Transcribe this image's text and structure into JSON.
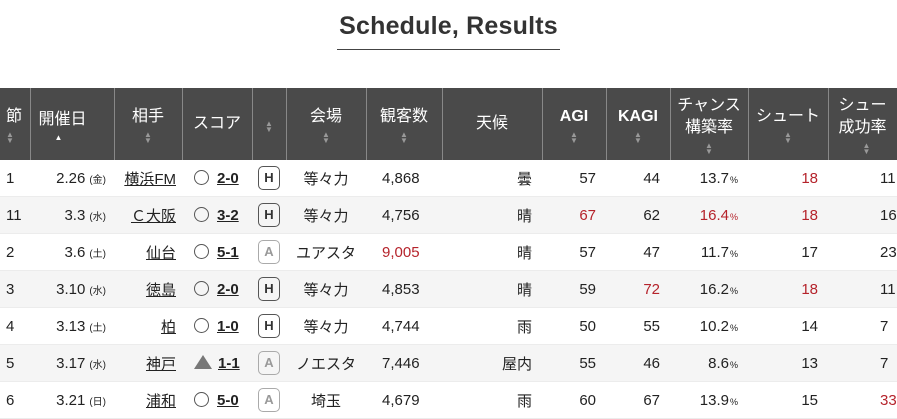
{
  "title": "Schedule, Results",
  "headers": {
    "sec": "節",
    "date": "開催日",
    "opponent": "相手",
    "score": "スコア",
    "venue": "会場",
    "attendance": "観客数",
    "weather": "天候",
    "agi": "AGI",
    "kagi": "KAGI",
    "chance_line1": "チャンス",
    "chance_line2": "構築率",
    "shoot": "シュート",
    "shoot_rate_line1": "シュー",
    "shoot_rate_line2": "成功率"
  },
  "rows": [
    {
      "sec": "1",
      "date": "2.26",
      "dow": "(金)",
      "opponent": "横浜FM",
      "result": "circle",
      "score": "2-0",
      "ha": "H",
      "venue": "等々力",
      "attendance": "4,868",
      "att_red": false,
      "weather": "曇",
      "agi": "57",
      "agi_red": false,
      "kagi": "44",
      "kagi_red": false,
      "chance": "13.7",
      "chance_red": false,
      "shoot": "18",
      "shoot_red": true,
      "sr": "11",
      "sr_red": false
    },
    {
      "sec": "11",
      "date": "3.3",
      "dow": "(水)",
      "opponent": "Ｃ大阪",
      "result": "circle",
      "score": "3-2",
      "ha": "H",
      "venue": "等々力",
      "attendance": "4,756",
      "att_red": false,
      "weather": "晴",
      "agi": "67",
      "agi_red": true,
      "kagi": "62",
      "kagi_red": false,
      "chance": "16.4",
      "chance_red": true,
      "shoot": "18",
      "shoot_red": true,
      "sr": "16",
      "sr_red": false
    },
    {
      "sec": "2",
      "date": "3.6",
      "dow": "(土)",
      "opponent": "仙台",
      "result": "circle",
      "score": "5-1",
      "ha": "A",
      "venue": "ユアスタ",
      "attendance": "9,005",
      "att_red": true,
      "weather": "晴",
      "agi": "57",
      "agi_red": false,
      "kagi": "47",
      "kagi_red": false,
      "chance": "11.7",
      "chance_red": false,
      "shoot": "17",
      "shoot_red": false,
      "sr": "23",
      "sr_red": false
    },
    {
      "sec": "3",
      "date": "3.10",
      "dow": "(水)",
      "opponent": "徳島",
      "result": "circle",
      "score": "2-0",
      "ha": "H",
      "venue": "等々力",
      "attendance": "4,853",
      "att_red": false,
      "weather": "晴",
      "agi": "59",
      "agi_red": false,
      "kagi": "72",
      "kagi_red": true,
      "chance": "16.2",
      "chance_red": false,
      "shoot": "18",
      "shoot_red": true,
      "sr": "11",
      "sr_red": false
    },
    {
      "sec": "4",
      "date": "3.13",
      "dow": "(土)",
      "opponent": "柏",
      "result": "circle",
      "score": "1-0",
      "ha": "H",
      "venue": "等々力",
      "attendance": "4,744",
      "att_red": false,
      "weather": "雨",
      "agi": "50",
      "agi_red": false,
      "kagi": "55",
      "kagi_red": false,
      "chance": "10.2",
      "chance_red": false,
      "shoot": "14",
      "shoot_red": false,
      "sr": "7",
      "sr_red": false
    },
    {
      "sec": "5",
      "date": "3.17",
      "dow": "(水)",
      "opponent": "神戸",
      "result": "triangle",
      "score": "1-1",
      "ha": "A",
      "venue": "ノエスタ",
      "attendance": "7,446",
      "att_red": false,
      "weather": "屋内",
      "agi": "55",
      "agi_red": false,
      "kagi": "46",
      "kagi_red": false,
      "chance": "8.6",
      "chance_red": false,
      "shoot": "13",
      "shoot_red": false,
      "sr": "7",
      "sr_red": false
    },
    {
      "sec": "6",
      "date": "3.21",
      "dow": "(日)",
      "opponent": "浦和",
      "result": "circle",
      "score": "5-0",
      "ha": "A",
      "venue": "埼玉",
      "attendance": "4,679",
      "att_red": false,
      "weather": "雨",
      "agi": "60",
      "agi_red": false,
      "kagi": "67",
      "kagi_red": false,
      "chance": "13.9",
      "chance_red": false,
      "shoot": "15",
      "shoot_red": false,
      "sr": "33",
      "sr_red": true
    }
  ],
  "pct_unit": "%",
  "colors": {
    "header_bg": "#4a4a4a",
    "accent_red": "#b5232b"
  }
}
